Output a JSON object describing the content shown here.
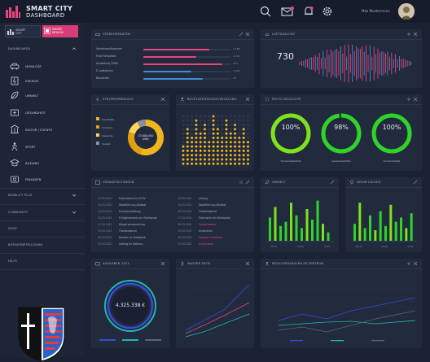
{
  "header": {
    "title_line1": "SMART CITY",
    "title_line2": "DASHBOARD",
    "user_name": "Max Mustermann",
    "notification_count": "3"
  },
  "sidebar": {
    "tabs": [
      {
        "label_line1": "SMART",
        "label_line2": "CITY"
      },
      {
        "label_line1": "SMART",
        "label_line2": "REGION"
      }
    ],
    "section_dashboards": "DASHBOARDS",
    "items": [
      {
        "label": "MOBILITÄT",
        "icon": "car-icon"
      },
      {
        "label": "ENERGIE",
        "icon": "energy-icon"
      },
      {
        "label": "UMWELT",
        "icon": "leaf-icon"
      },
      {
        "label": "GESUNDHEIT",
        "icon": "health-icon"
      },
      {
        "label": "KULTUR / EVENTS",
        "icon": "culture-icon"
      },
      {
        "label": "SPORT",
        "icon": "sport-icon"
      },
      {
        "label": "BILDUNG",
        "icon": "education-icon"
      },
      {
        "label": "FINANZEN",
        "icon": "finance-icon"
      }
    ],
    "section_mobility_plus": "MOBILITY PLUS",
    "section_community": "COMMUNITY",
    "section_shop": "SHOP",
    "section_citizen": "BÜRGERBETEILIGUNG",
    "section_help": "HILFE"
  },
  "panels": {
    "traffic": {
      "title": "VERKEHRSDATEN",
      "rows": [
        {
          "label": "Verkehrsaufkommen",
          "value": "1.180",
          "pct": 0.75,
          "color": "#e8457a"
        },
        {
          "label": "Freie Parkplätze",
          "value": "1.234",
          "pct": 0.6,
          "color": "#e8457a"
        },
        {
          "label": "Auslastung ÖPNV",
          "value": "97%",
          "pct": 0.9,
          "color": "#e8457a"
        },
        {
          "label": "E-Ladesäulen",
          "value": "1.210",
          "pct": 0.55,
          "color": "#3a8fd6"
        },
        {
          "label": "Baustellen",
          "value": "12",
          "pct": 0.68,
          "color": "#3a8fd6"
        }
      ]
    },
    "air": {
      "title": "LUFTQUALITÄT",
      "value": "730"
    },
    "energy": {
      "title": "STROMVERBRAUCH",
      "legend": [
        "Haushalte",
        "Industrie",
        "Gewerbe",
        "Verkehr"
      ],
      "center_value": "23.000.000",
      "center_unit": "kWh",
      "slices": [
        0.55,
        0.25,
        0.12,
        0.08
      ]
    },
    "population": {
      "title": "BEVÖLKERUNGSENTWICKLUNG"
    },
    "recycling": {
      "title": "RECYCLINGQUOTE",
      "rings": [
        {
          "value": "100%",
          "label": "Haushaltsabfälle",
          "pct": 1.0
        },
        {
          "value": "98%",
          "label": "Gewerbeabfälle",
          "pct": 0.98
        },
        {
          "value": "100%",
          "label": "Sonderabfälle",
          "pct": 1.0
        }
      ]
    },
    "events": {
      "title": "VERANSTALTUNGEN",
      "left": [
        {
          "date": "12.03.2021",
          "text": "Kulturabend im TCSV"
        },
        {
          "date": "13.03.2021",
          "text": "Stadtführung Altstadt"
        },
        {
          "date": "14.03.2021",
          "text": "Kunstausstellung"
        },
        {
          "date": "15.03.2021",
          "text": "Frühjahrsmarkt am Marktplatz"
        },
        {
          "date": "17.03.2021",
          "text": "Bürgerversammlung"
        },
        {
          "date": "19.03.2021",
          "text": "Theaterabend"
        },
        {
          "date": "20.03.2021",
          "text": "Konzert im Stadtpark"
        },
        {
          "date": "22.03.2021",
          "text": "Vortrag im Rathaus"
        }
      ],
      "right": [
        {
          "date": "24.03.2021",
          "text": "Lesung"
        },
        {
          "date": "25.03.2021",
          "text": "Stadtführung Altstadt"
        },
        {
          "date": "26.03.2021",
          "text": "Theaterabend"
        },
        {
          "date": "27.03.2021",
          "text": "Flohmarkt am Marktplatz"
        },
        {
          "date": "28.03.2021",
          "text": "Konzertabend",
          "highlight": true
        },
        {
          "date": "29.03.2021",
          "text": "Kinderkino"
        },
        {
          "date": "30.03.2021",
          "text": "Vortrag im Rathaus",
          "highlight": true
        },
        {
          "date": "31.03.2021",
          "text": "Kunstmarkt",
          "highlight": true
        }
      ]
    },
    "env": {
      "title": "UMWELT",
      "labels": [
        "2019",
        "2020",
        "2021"
      ]
    },
    "green": {
      "title": "GRÜNFLÄCHEN",
      "labels": [
        "2019",
        "2020",
        "2021"
      ]
    },
    "budget": {
      "title": "AUSGABEN 2021",
      "value": "4.325.338 €"
    },
    "water": {
      "title": "WASSER DECK"
    },
    "visitors": {
      "title": "BESUCHERZAHLEN IM ZENTRUM"
    }
  },
  "colors": {
    "pink": "#e8457a",
    "green": "#3ccb2c",
    "blue": "#3a8fd6",
    "yellow": "#f0b71c",
    "teal": "#1fb8b0"
  }
}
